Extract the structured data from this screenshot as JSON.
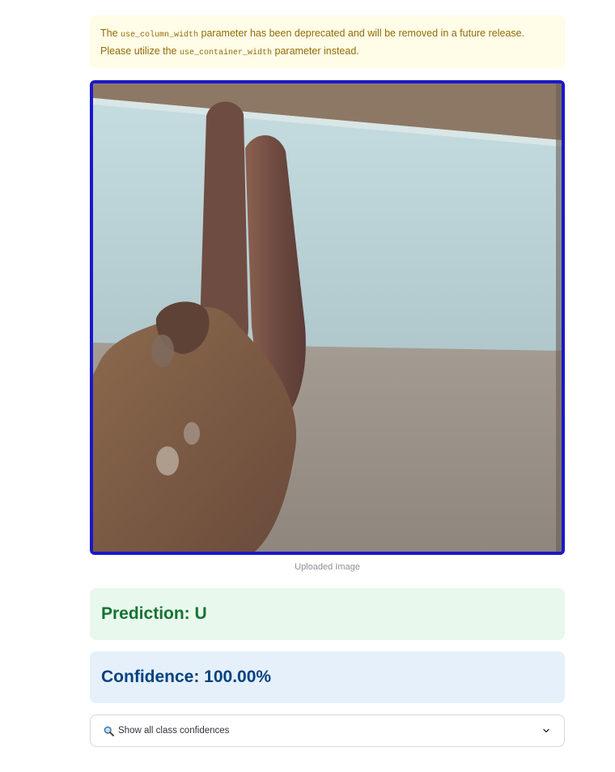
{
  "warning": {
    "prefix": "The",
    "param_old": "use_column_width",
    "middle": "parameter has been deprecated and will be removed in a future release. Please utilize the",
    "param_new": "use_container_width",
    "suffix": "parameter instead."
  },
  "image": {
    "caption": "Uploaded Image",
    "border_color": "#1a18c8"
  },
  "prediction": {
    "text": "Prediction: U",
    "color": "#177233"
  },
  "confidence": {
    "text": "Confidence: 100.00%",
    "color": "#004280"
  },
  "expander": {
    "icon": "magnifying-glass-icon",
    "label": "Show all class confidences",
    "toggle_icon": "chevron-down-icon"
  }
}
